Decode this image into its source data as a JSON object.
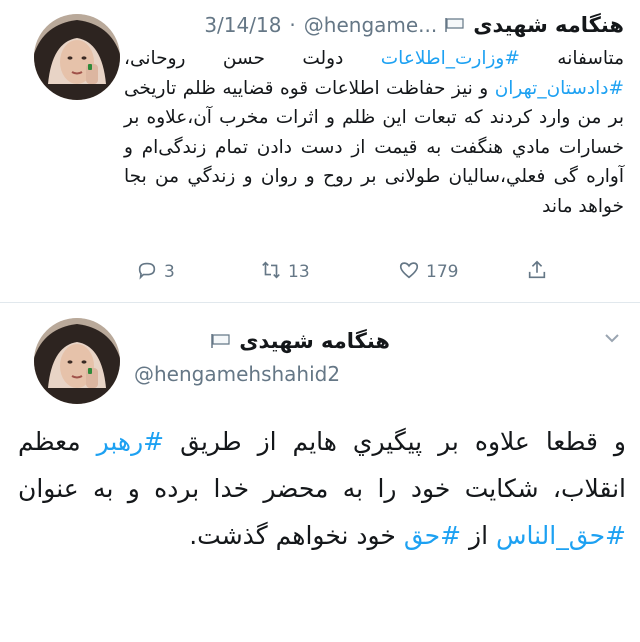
{
  "tweet1": {
    "name": "هنگامه شهیدی",
    "handle": "@hengame...",
    "separator": "·",
    "date": "3/14/18",
    "body": [
      {
        "t": "متاسفانه ",
        "h": false
      },
      {
        "t": "#وزارت_اطلاعات",
        "h": true
      },
      {
        "t": " دولت حسن روحانی، ",
        "h": false
      },
      {
        "t": "#دادستان_تهران",
        "h": true
      },
      {
        "t": " و نیز حفاظت اطلاعات قوه قضاییه ظلم تاریخی بر من وارد کردند که تبعات این ظلم و اثرات مخرب آن،علاوه بر خسارات مادي هنگفت به قیمت از دست دادن تمام زندگی‌ام و آواره گی فعلي،ساليان طولانی بر روح و روان و زندگي من بجا خواهد ماند",
        "h": false
      }
    ],
    "actions": {
      "replies": "3",
      "retweets": "13",
      "likes": "179"
    }
  },
  "tweet2": {
    "name": "هنگامه شهیدی",
    "handle": "@hengamehshahid2",
    "body": [
      {
        "t": "و قطعا علاوه بر  پیگیري هایم از طریق ",
        "h": false
      },
      {
        "t": "#رهبر",
        "h": true
      },
      {
        "t": " معظم انقلاب، شکایت خود را به محضر خدا برده و به عنوان ",
        "h": false
      },
      {
        "t": "#حق_الناس",
        "h": true
      },
      {
        "t": " از ",
        "h": false
      },
      {
        "t": "#حق",
        "h": true
      },
      {
        "t": " خود نخواهم گذشت.",
        "h": false
      }
    ]
  },
  "colors": {
    "link": "#1da1f2",
    "meta": "#657786",
    "text": "#14171a"
  }
}
